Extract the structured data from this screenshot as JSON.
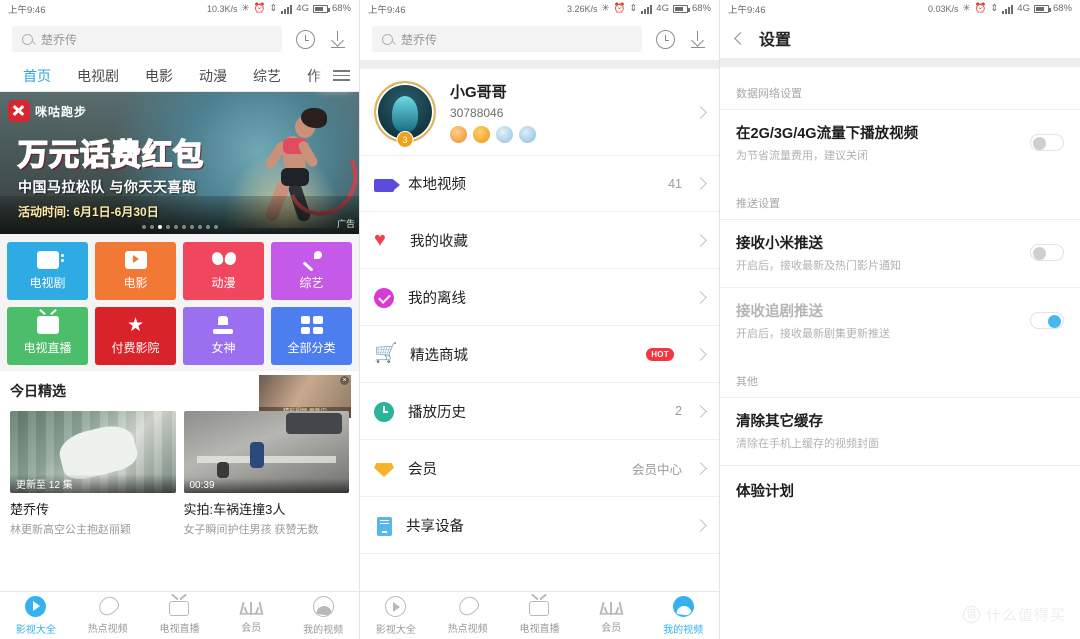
{
  "panels": [
    {
      "statusbar": {
        "time": "上午9:46",
        "speed": "10.3K/s",
        "network": "4G",
        "battery": "68%"
      },
      "search": {
        "placeholder": "楚乔传"
      },
      "tabs": [
        {
          "label": "首页",
          "active": true
        },
        {
          "label": "电视剧",
          "active": false
        },
        {
          "label": "电影",
          "active": false
        },
        {
          "label": "动漫",
          "active": false
        },
        {
          "label": "综艺",
          "active": false
        },
        {
          "label": "作",
          "active": false
        }
      ],
      "banner": {
        "brand": "咪咕跑步",
        "line1": "万元话费红包",
        "line2": "中国马拉松队 与你天天喜跑",
        "line3": "活动时间: 6月1日-6月30日",
        "ad_label": "广告"
      },
      "categories": [
        {
          "label": "电视剧",
          "color": "#2eabe2",
          "icon": "tv-series-icon"
        },
        {
          "label": "电影",
          "color": "#f27935",
          "icon": "movie-icon"
        },
        {
          "label": "动漫",
          "color": "#f0475f",
          "icon": "anime-icon"
        },
        {
          "label": "综艺",
          "color": "#c65ae8",
          "icon": "variety-mic-icon"
        },
        {
          "label": "电视直播",
          "color": "#4cbd6a",
          "icon": "live-tv-icon"
        },
        {
          "label": "付费影院",
          "color": "#d8232a",
          "icon": "star-icon"
        },
        {
          "label": "女神",
          "color": "#9a6ff0",
          "icon": "goddess-icon"
        },
        {
          "label": "全部分类",
          "color": "#4d7ef0",
          "icon": "grid-all-icon"
        }
      ],
      "section": {
        "title": "今日精选",
        "ad_caption": "精彩视频 更新中"
      },
      "videos": [
        {
          "title": "楚乔传",
          "subtitle": "林更新高空公主抱赵丽颖",
          "badge": "更新至 12 集"
        },
        {
          "title": "实拍:车祸连撞3人",
          "subtitle": "女子瞬间护住男孩 获赞无数",
          "badge": "00:39"
        }
      ],
      "bottomnav": [
        {
          "label": "影视大全",
          "icon": "play-circle-icon",
          "active": true
        },
        {
          "label": "热点视频",
          "icon": "fire-icon",
          "active": false
        },
        {
          "label": "电视直播",
          "icon": "tv-antenna-icon",
          "active": false
        },
        {
          "label": "会员",
          "icon": "crown-icon",
          "active": false
        },
        {
          "label": "我的视频",
          "icon": "profile-icon",
          "active": false
        }
      ]
    },
    {
      "statusbar": {
        "time": "上午9:46",
        "speed": "3.26K/s",
        "network": "4G",
        "battery": "68%"
      },
      "search": {
        "placeholder": "楚乔传"
      },
      "profile": {
        "name": "小G哥哥",
        "id": "30788046",
        "level": "3",
        "badge_colors": [
          "#f0913a",
          "#f2a41c",
          "#9cc9e4",
          "#8fc3e6"
        ]
      },
      "menu": [
        {
          "label": "本地视频",
          "right": "41",
          "icon": "local-video-icon",
          "badge": ""
        },
        {
          "label": "我的收藏",
          "right": "",
          "icon": "heart-icon",
          "badge": ""
        },
        {
          "label": "我的离线",
          "right": "",
          "icon": "offline-check-icon",
          "badge": ""
        },
        {
          "label": "精选商城",
          "right": "",
          "icon": "cart-icon",
          "badge": "HOT"
        },
        {
          "label": "播放历史",
          "right": "2",
          "icon": "history-clock-icon",
          "badge": ""
        },
        {
          "label": "会员",
          "right": "会员中心",
          "icon": "vip-diamond-icon",
          "badge": ""
        },
        {
          "label": "共享设备",
          "right": "",
          "icon": "device-icon",
          "badge": ""
        }
      ],
      "bottomnav": [
        {
          "label": "影视大全",
          "icon": "play-circle-icon",
          "active": false
        },
        {
          "label": "热点视频",
          "icon": "fire-icon",
          "active": false
        },
        {
          "label": "电视直播",
          "icon": "tv-antenna-icon",
          "active": false
        },
        {
          "label": "会员",
          "icon": "crown-icon",
          "active": false
        },
        {
          "label": "我的视频",
          "icon": "profile-icon",
          "active": true
        }
      ]
    },
    {
      "statusbar": {
        "time": "上午9:46",
        "speed": "0.03K/s",
        "network": "4G",
        "battery": "68%"
      },
      "header": {
        "title": "设置",
        "back_icon": "back-chevron-icon"
      },
      "groups": [
        {
          "label": "数据网络设置",
          "rows": [
            {
              "main": "在2G/3G/4G流量下播放视频",
              "sub": "为节省流量费用，建议关闭",
              "toggle": "off",
              "muted": false
            }
          ]
        },
        {
          "label": "推送设置",
          "rows": [
            {
              "main": "接收小米推送",
              "sub": "开启后，接收最新及热门影片通知",
              "toggle": "off",
              "muted": false
            },
            {
              "main": "接收追剧推送",
              "sub": "开启后，接收最新剧集更新推送",
              "toggle": "on",
              "muted": true
            }
          ]
        },
        {
          "label": "其他",
          "rows": [
            {
              "main": "清除其它缓存",
              "sub": "清除在手机上缓存的视频封面",
              "toggle": "none",
              "muted": false
            },
            {
              "main": "体验计划",
              "sub": "",
              "toggle": "none",
              "muted": false
            }
          ]
        }
      ],
      "watermark": {
        "mark": "值",
        "text": "什么值得买"
      }
    }
  ]
}
